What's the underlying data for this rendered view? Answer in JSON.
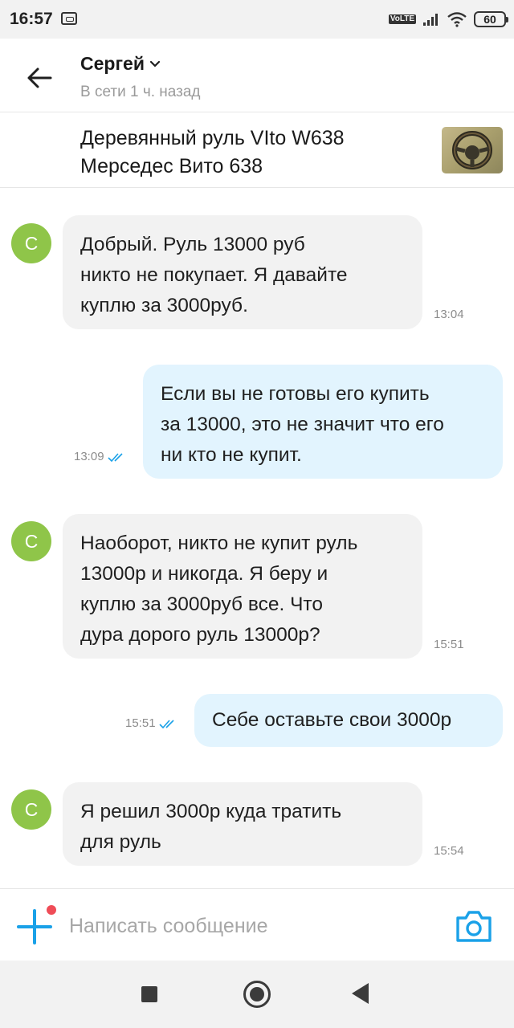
{
  "status_bar": {
    "time": "16:57",
    "network": "VoLTE",
    "battery": "60"
  },
  "header": {
    "contact_name": "Сергей",
    "contact_status": "В сети 1 ч. назад"
  },
  "listing": {
    "title": "Деревянный руль VIto W638 Мерседес Вито 638"
  },
  "messages": [
    {
      "direction": "in",
      "avatar_letter": "С",
      "text": "Добрый. Руль 13000 руб\nникто не покупает. Я давайте\nкуплю за 3000руб.",
      "time": "13:04"
    },
    {
      "direction": "out",
      "text": "Если вы не готовы его купить\nза 13000, это не значит что его\nни кто не купит.",
      "time": "13:09",
      "read": true
    },
    {
      "direction": "in",
      "avatar_letter": "С",
      "text": "Наоборот, никто не купит руль\n13000р и никогда. Я беру и\nкуплю за 3000руб все. Что\nдура дорого руль 13000р?",
      "time": "15:51"
    },
    {
      "direction": "out",
      "text": "Себе оставьте свои 3000р",
      "time": "15:51",
      "read": true
    },
    {
      "direction": "in",
      "avatar_letter": "С",
      "text": "Я решил 3000р куда тратить\nдля руль",
      "time": "15:54"
    }
  ],
  "composer": {
    "placeholder": "Написать сообщение"
  },
  "colors": {
    "accent": "#1aa1e8",
    "avatar_green": "#8fc549",
    "incoming_bubble": "#f2f2f2",
    "outgoing_bubble": "#e2f4fe",
    "notification_dot": "#ef4c57"
  },
  "icons": {
    "back": "arrow-left-icon",
    "dropdown": "chevron-down-icon",
    "attach": "plus-icon",
    "camera": "camera-icon",
    "read_receipt": "double-check-icon"
  }
}
